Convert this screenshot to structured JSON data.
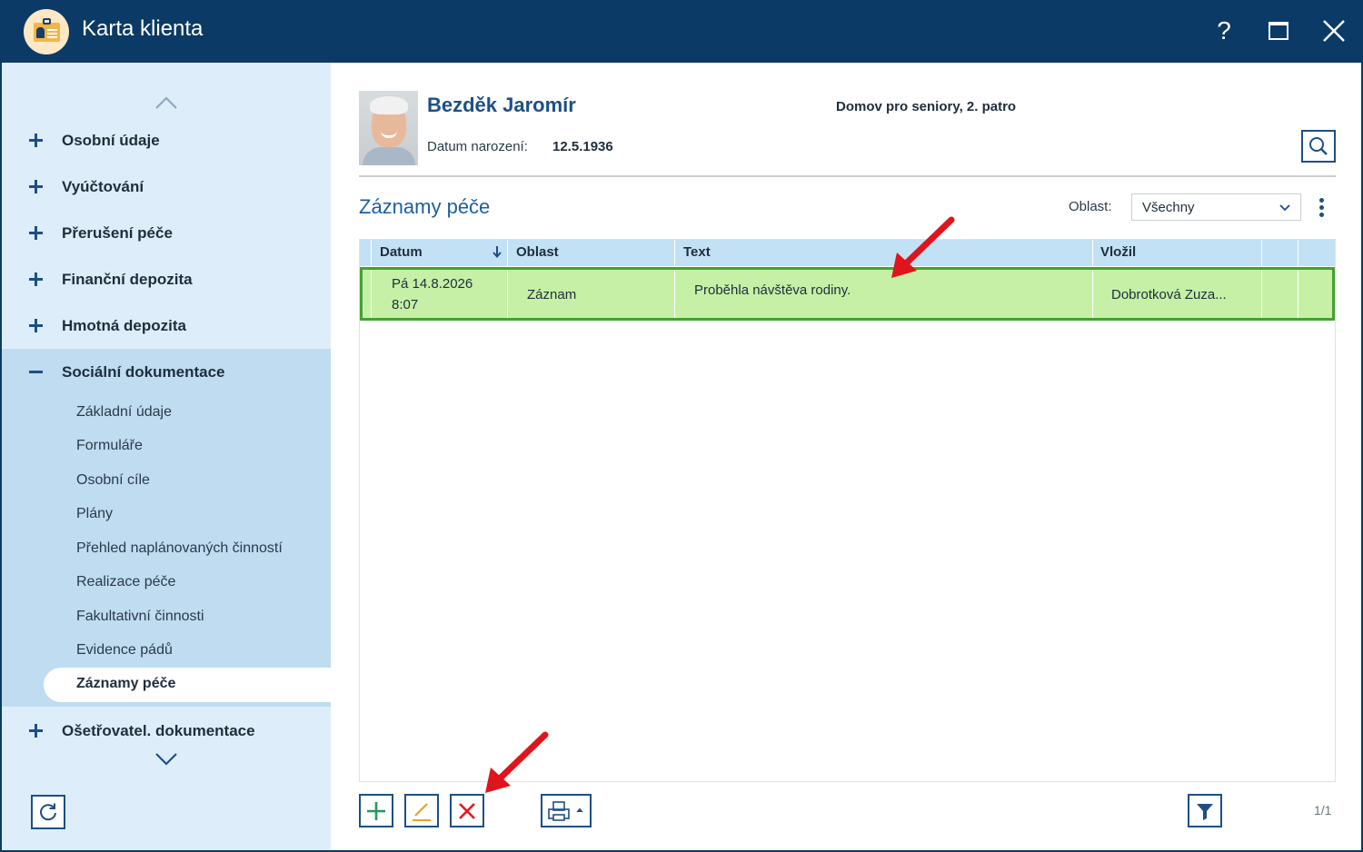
{
  "window": {
    "title": "Karta klienta",
    "help_label": "?"
  },
  "sidebar": {
    "items": [
      {
        "label": "Osobní údaje"
      },
      {
        "label": "Vyúčtování"
      },
      {
        "label": "Přerušení péče"
      },
      {
        "label": "Finanční depozita"
      },
      {
        "label": "Hmotná depozita"
      },
      {
        "label": "Sociální dokumentace"
      },
      {
        "label": "Ošetřovatel. dokumentace"
      }
    ],
    "subitems": [
      {
        "label": "Základní údaje"
      },
      {
        "label": "Formuláře"
      },
      {
        "label": "Osobní cíle"
      },
      {
        "label": "Plány"
      },
      {
        "label": "Přehled naplánovaných činností"
      },
      {
        "label": "Realizace péče"
      },
      {
        "label": "Fakultativní činnosti"
      },
      {
        "label": "Evidence pádů"
      },
      {
        "label": "Záznamy péče"
      }
    ]
  },
  "client": {
    "name": "Bezděk Jaromír",
    "dob_label": "Datum narození:",
    "dob": "12.5.1936",
    "facility": "Domov pro seniory, 2. patro"
  },
  "section": {
    "title": "Záznamy péče",
    "area_label": "Oblast:",
    "area_value": "Všechny"
  },
  "table": {
    "columns": [
      "Datum",
      "Oblast",
      "Text",
      "Vložil"
    ],
    "rows": [
      {
        "datum_line1": "Pá 14.8.2026",
        "datum_line2": "8:07",
        "oblast": "Záznam",
        "text": "Proběhla návštěva rodiny.",
        "vlozil": "Dobrotková Zuza..."
      }
    ]
  },
  "pager": "1/1",
  "colors": {
    "titlebar": "#0b3a66",
    "accent": "#1d4f86",
    "sidebar_bg": "#ddeefa",
    "sidebar_active_bg": "#bfdcf1",
    "row_selected_bg": "#c6f0a6",
    "row_selected_border": "#43a230",
    "annotation_arrow": "#e0141c"
  },
  "icons": {
    "app": "client-card-icon",
    "help": "help-icon",
    "maximize": "maximize-icon",
    "close": "close-icon",
    "refresh": "refresh-icon",
    "search": "search-icon",
    "add": "add-icon",
    "edit": "edit-icon",
    "delete": "delete-icon",
    "print": "print-icon",
    "filter": "filter-icon"
  }
}
